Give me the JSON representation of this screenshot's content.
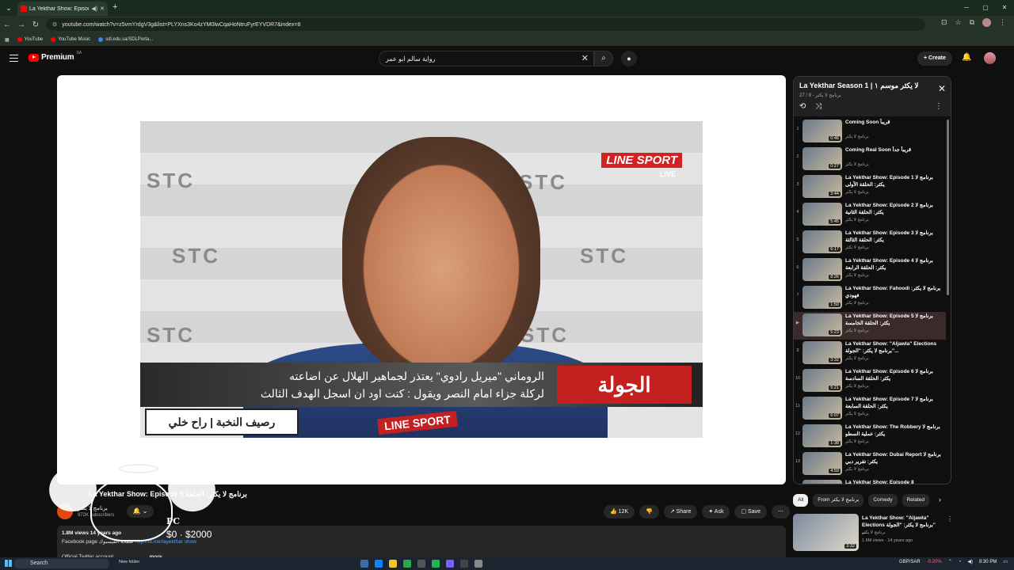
{
  "browser": {
    "tab_title": "La Yekthar Show: Episode 5",
    "url": "youtube.com/watch?v=z5vmYrdgV3g&list=PLYXns3Ko4zYM0lwCqaHoNtruFyrEYVDR7&index=8",
    "bookmarks": [
      {
        "label": "YouTube",
        "color": "#ff0000"
      },
      {
        "label": "YouTube Music",
        "color": "#ff0000"
      },
      {
        "label": "sdl.edu.sa/SDLPorta...",
        "color": "#3b82f6"
      }
    ]
  },
  "header": {
    "logo_text": "Premium",
    "logo_region": "SA",
    "search_value": "رواية سالم ابو عمر",
    "create_label": "Create"
  },
  "video": {
    "overlay_ticker_line1": "الروماني \"ميريل رادوي\" يعتذر لجماهير الهلال عن اضاعته",
    "overlay_ticker_line2": "لركلة جزاء امام النصر ويقول : كنت اود ان اسجل الهدف الثالث",
    "overlay_jawla": "الجولة",
    "overlay_bottom_tag": "رصيف النخبة | راح خلي",
    "overlay_linesport": "LINE SPORT",
    "overlay_live": "LIVE",
    "stc_text": "STC",
    "title": "La Yekthar Show: Episode 5 برنامج لا يكثر: الحلقة",
    "channel_name": "برنامج لا يكثر",
    "channel_subs": "972K subscribers",
    "likes": "12K",
    "share_label": "Share",
    "ask_label": "Ask",
    "save_label": "Save",
    "views_line": "1.8M views  14 years ago",
    "facebook_line": "Facebook page صفحة الفيسبوك",
    "facebook_link": "http://fb.me/layekthar show",
    "twitter_line": "Official Twitter account",
    "more_label": "...more"
  },
  "overlay_widget": {
    "pc_label": "PC",
    "money_label": "$0 · $2000"
  },
  "playlist": {
    "title": "La Yekthar Season 1 | لا يكثر موسم ١",
    "subtitle": "برنامج لا يكثر - 8 / 27",
    "items": [
      {
        "idx": "1",
        "title": "Coming Soon قريباً",
        "channel": "برنامج لا يكثر",
        "duration": "0:46"
      },
      {
        "idx": "2",
        "title": "Coming Real Soon قريباً جداً",
        "channel": "برنامج لا يكثر",
        "duration": "0:27"
      },
      {
        "idx": "3",
        "title": "La Yekthar Show: Episode 1 برنامج لا يكثر: الحلقة الأولى",
        "channel": "برنامج لا يكثر",
        "duration": "3:44"
      },
      {
        "idx": "4",
        "title": "La Yekthar Show: Episode 2 برنامج لا يكثر: الحلقة الثانية",
        "channel": "برنامج لا يكثر",
        "duration": "5:45"
      },
      {
        "idx": "5",
        "title": "La Yekthar Show: Episode 3 برنامج لا يكثر: الحلقة الثالثة",
        "channel": "برنامج لا يكثر",
        "duration": "6:17"
      },
      {
        "idx": "6",
        "title": "La Yekthar Show: Episode 4 برنامج لا يكثر: الحلقة الرابعة",
        "channel": "برنامج لا يكثر",
        "duration": "8:26"
      },
      {
        "idx": "7",
        "title": "La Yekthar Show: Fahoodi برنامج لا يكثر: فهودي",
        "channel": "برنامج لا يكثر",
        "duration": "1:50"
      },
      {
        "idx": "▶",
        "title": "La Yekthar Show: Episode 5 برنامج لا يكثر: الحلقة الخامسة",
        "channel": "برنامج لا يكثر",
        "duration": "5:23"
      },
      {
        "idx": "9",
        "title": "La Yekthar Show: \"Aljawla\" Elections برنامج لا يكثر: \"الجولة\"...",
        "channel": "برنامج لا يكثر",
        "duration": "3:32"
      },
      {
        "idx": "10",
        "title": "La Yekthar Show: Episode 6 برنامج لا يكثر: الحلقة السادسة",
        "channel": "برنامج لا يكثر",
        "duration": "5:21"
      },
      {
        "idx": "11",
        "title": "La Yekthar Show: Episode 7 برنامج لا يكثر: الحلقة السابعة",
        "channel": "برنامج لا يكثر",
        "duration": "6:07"
      },
      {
        "idx": "12",
        "title": "La Yekthar Show: The Robbery برنامج لا يكثر: عملية السطو",
        "channel": "برنامج لا يكثر",
        "duration": "1:38"
      },
      {
        "idx": "13",
        "title": "La Yekthar Show: Dubai Report برنامج لا يكثر: تقرير دبي",
        "channel": "برنامج لا يكثر",
        "duration": "4:59"
      },
      {
        "idx": "14",
        "title": "La Yekthar Show: Episode 8",
        "channel": "برنامج لا يكثر",
        "duration": ""
      }
    ]
  },
  "chips": [
    "All",
    "From برنامج لا يكثر",
    "Comedy",
    "Related"
  ],
  "recommendation": {
    "title": "La Yekthar Show: \"Aljawla\" Elections برنامج لا يكثر: \"الجولة\" ...",
    "channel": "برنامج لا يكثر",
    "meta": "1.6M views · 14 years ago",
    "duration": "3:32"
  },
  "taskbar": {
    "search_label": "Search",
    "new_folder": "New folder",
    "ticker": "GBP/SAR",
    "ticker_value": "-0.20%",
    "time": "8:30 PM"
  }
}
